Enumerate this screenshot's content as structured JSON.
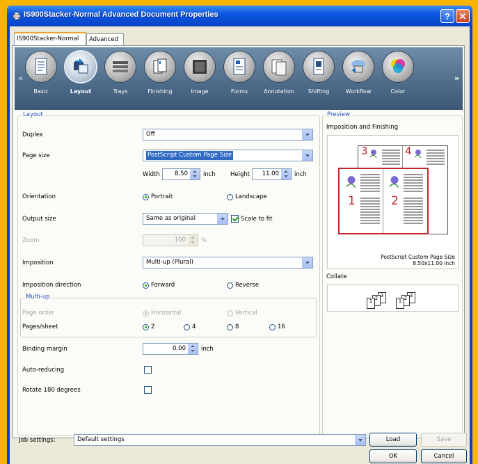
{
  "window": {
    "title": "IS900Stacker-Normal Advanced Document Properties",
    "help_label": "?",
    "close_label": "✕"
  },
  "tabs": [
    {
      "label": "IS900Stacker-Normal",
      "active": true
    },
    {
      "label": "Advanced",
      "active": false
    }
  ],
  "categories": [
    {
      "label": "Basic",
      "icon": "document-icon",
      "selected": false
    },
    {
      "label": "Layout",
      "icon": "layout-icon",
      "selected": true
    },
    {
      "label": "Trays",
      "icon": "trays-icon",
      "selected": false
    },
    {
      "label": "Finishing",
      "icon": "finishing-icon",
      "selected": false
    },
    {
      "label": "Image",
      "icon": "image-icon",
      "selected": false
    },
    {
      "label": "Forms",
      "icon": "forms-icon",
      "selected": false
    },
    {
      "label": "Annotation",
      "icon": "annotation-icon",
      "selected": false
    },
    {
      "label": "Shifting",
      "icon": "shifting-icon",
      "selected": false
    },
    {
      "label": "Workflow",
      "icon": "workflow-icon",
      "selected": false
    },
    {
      "label": "Color",
      "icon": "color-icon",
      "selected": false
    }
  ],
  "nav": {
    "prev": "«",
    "next": "»"
  },
  "layout": {
    "group_title": "Layout",
    "duplex": {
      "label": "Duplex",
      "value": "Off"
    },
    "page_size": {
      "label": "Page size",
      "value": "PostScript Custom Page Size"
    },
    "width": {
      "label": "Width",
      "value": "8.50",
      "unit": "inch"
    },
    "height": {
      "label": "Height",
      "value": "11.00",
      "unit": "inch"
    },
    "orientation": {
      "label": "Orientation",
      "options": [
        "Portrait",
        "Landscape"
      ],
      "selected": "Portrait"
    },
    "output_size": {
      "label": "Output size",
      "value": "Same as original",
      "scale_to_fit_label": "Scale to fit",
      "scale_to_fit": true
    },
    "zoom": {
      "label": "Zoom",
      "value": "100",
      "unit": "%"
    },
    "imposition": {
      "label": "Imposition",
      "value": "Multi-up (Plural)"
    },
    "imposition_direction": {
      "label": "Imposition direction",
      "options": [
        "Forward",
        "Reverse"
      ],
      "selected": "Forward"
    },
    "multiup": {
      "group_title": "Multi-up",
      "page_order": {
        "label": "Page order",
        "options": [
          "Horizontal",
          "Vertical"
        ],
        "selected": "Horizontal"
      },
      "pages_sheet": {
        "label": "Pages/sheet",
        "options": [
          "2",
          "4",
          "8",
          "16"
        ],
        "selected": "2"
      }
    },
    "binding_margin": {
      "label": "Binding margin",
      "value": "0.00",
      "unit": "inch"
    },
    "auto_reducing": {
      "label": "Auto-reducing",
      "checked": false
    },
    "rotate_180": {
      "label": "Rotate 180 degrees",
      "checked": false
    }
  },
  "preview": {
    "group_title": "Preview",
    "imposition_title": "Imposition and Finishing",
    "page_numbers": [
      "3",
      "4",
      "1",
      "2"
    ],
    "caption_line1": "PostScript Custom Page Size",
    "caption_line2": "8.50x11.00 inch",
    "collate_title": "Collate",
    "collate_numbers": [
      "1",
      "2",
      "3"
    ]
  },
  "job_settings": {
    "label": "Job settings:",
    "value": "Default settings",
    "load_label": "Load",
    "save_label": "Save"
  },
  "footer": {
    "ok_label": "OK",
    "cancel_label": "Cancel"
  },
  "colors": {
    "title_bar": "#0b55e0",
    "ribbon": "#4d6b89",
    "accent_red": "#c0282f",
    "selection": "#316ac5"
  }
}
